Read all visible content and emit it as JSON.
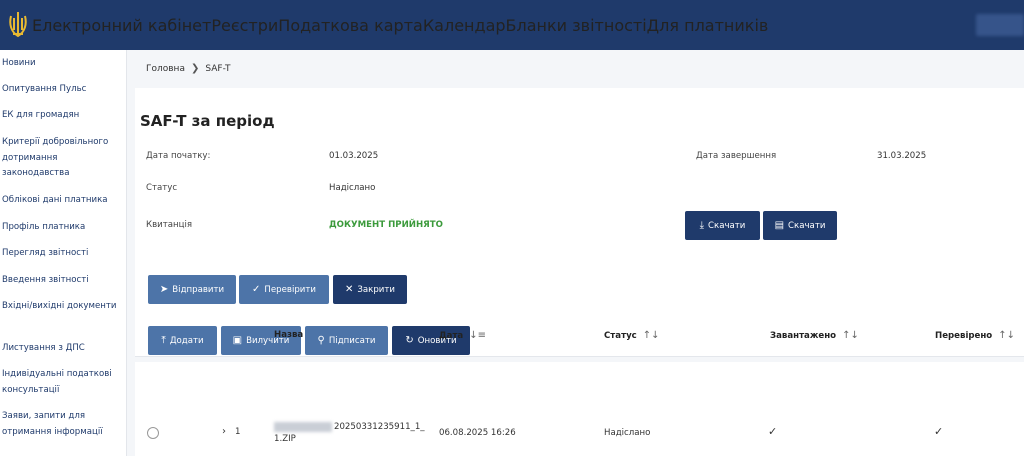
{
  "header": {
    "nav": [
      {
        "label": "Електронний кабінет"
      },
      {
        "label": "Реєстри"
      },
      {
        "label": "Податкова карта"
      },
      {
        "label": "Календар"
      },
      {
        "label": "Бланки звітності"
      },
      {
        "label": "Для платників"
      }
    ]
  },
  "sidebar": {
    "items": [
      {
        "label": "Новини"
      },
      {
        "label": "Опитування Пульс"
      },
      {
        "label": "ЕК для громадян"
      },
      {
        "label": "Критерії добровільного дотримання законодавства"
      },
      {
        "label": "Облікові дані платника"
      },
      {
        "label": "Профіль платника"
      },
      {
        "label": "Перегляд звітності"
      },
      {
        "label": "Введення звітності"
      },
      {
        "label": "Вхідні/вихідні документи"
      },
      {
        "label": "Листування з ДПС"
      },
      {
        "label": "Індивідуальні податкові консультації"
      },
      {
        "label": "Заяви, запити для отримання інформації"
      }
    ]
  },
  "breadcrumb": {
    "home": "Головна",
    "sep": "❯",
    "current": "SAF-T"
  },
  "page": {
    "title": "SAF-T за період",
    "fields": {
      "start_label": "Дата початку:",
      "start_value": "01.03.2025",
      "end_label": "Дата завершення",
      "end_value": "31.03.2025",
      "status_label": "Статус",
      "status_value": "Надіслано",
      "receipt_label": "Квитанція",
      "receipt_value": "ДОКУМЕНТ ПРИЙНЯТО"
    },
    "download_buttons": [
      "Скачати",
      "Скачати"
    ],
    "actions": {
      "send": "Відправити",
      "check": "Перевірити",
      "close": "Закрити"
    },
    "toolbar": {
      "add": "Додати",
      "delete": "Вилучити",
      "sign": "Підписати",
      "refresh": "Оновити"
    }
  },
  "table": {
    "columns": {
      "name": "Назва",
      "date": "Дата",
      "status": "Статус",
      "uploaded": "Завантажено",
      "checked": "Перевірено"
    },
    "sort_icon": "↑↓",
    "sort_active": "↓≡",
    "rows": [
      {
        "index": "1",
        "name_line1": "20250331235911_1_",
        "name_line2": "1.ZIP",
        "date": "06.08.2025 16:26",
        "status": "Надіслано",
        "uploaded": "✓",
        "checked": "✓"
      }
    ]
  },
  "icons": {
    "chevron": "›",
    "check": "✓"
  },
  "colors": {
    "header": "#1f3a6b",
    "primary_button": "#1f3a6b",
    "secondary_button": "#4d74a8",
    "success": "#3b9a3b"
  }
}
